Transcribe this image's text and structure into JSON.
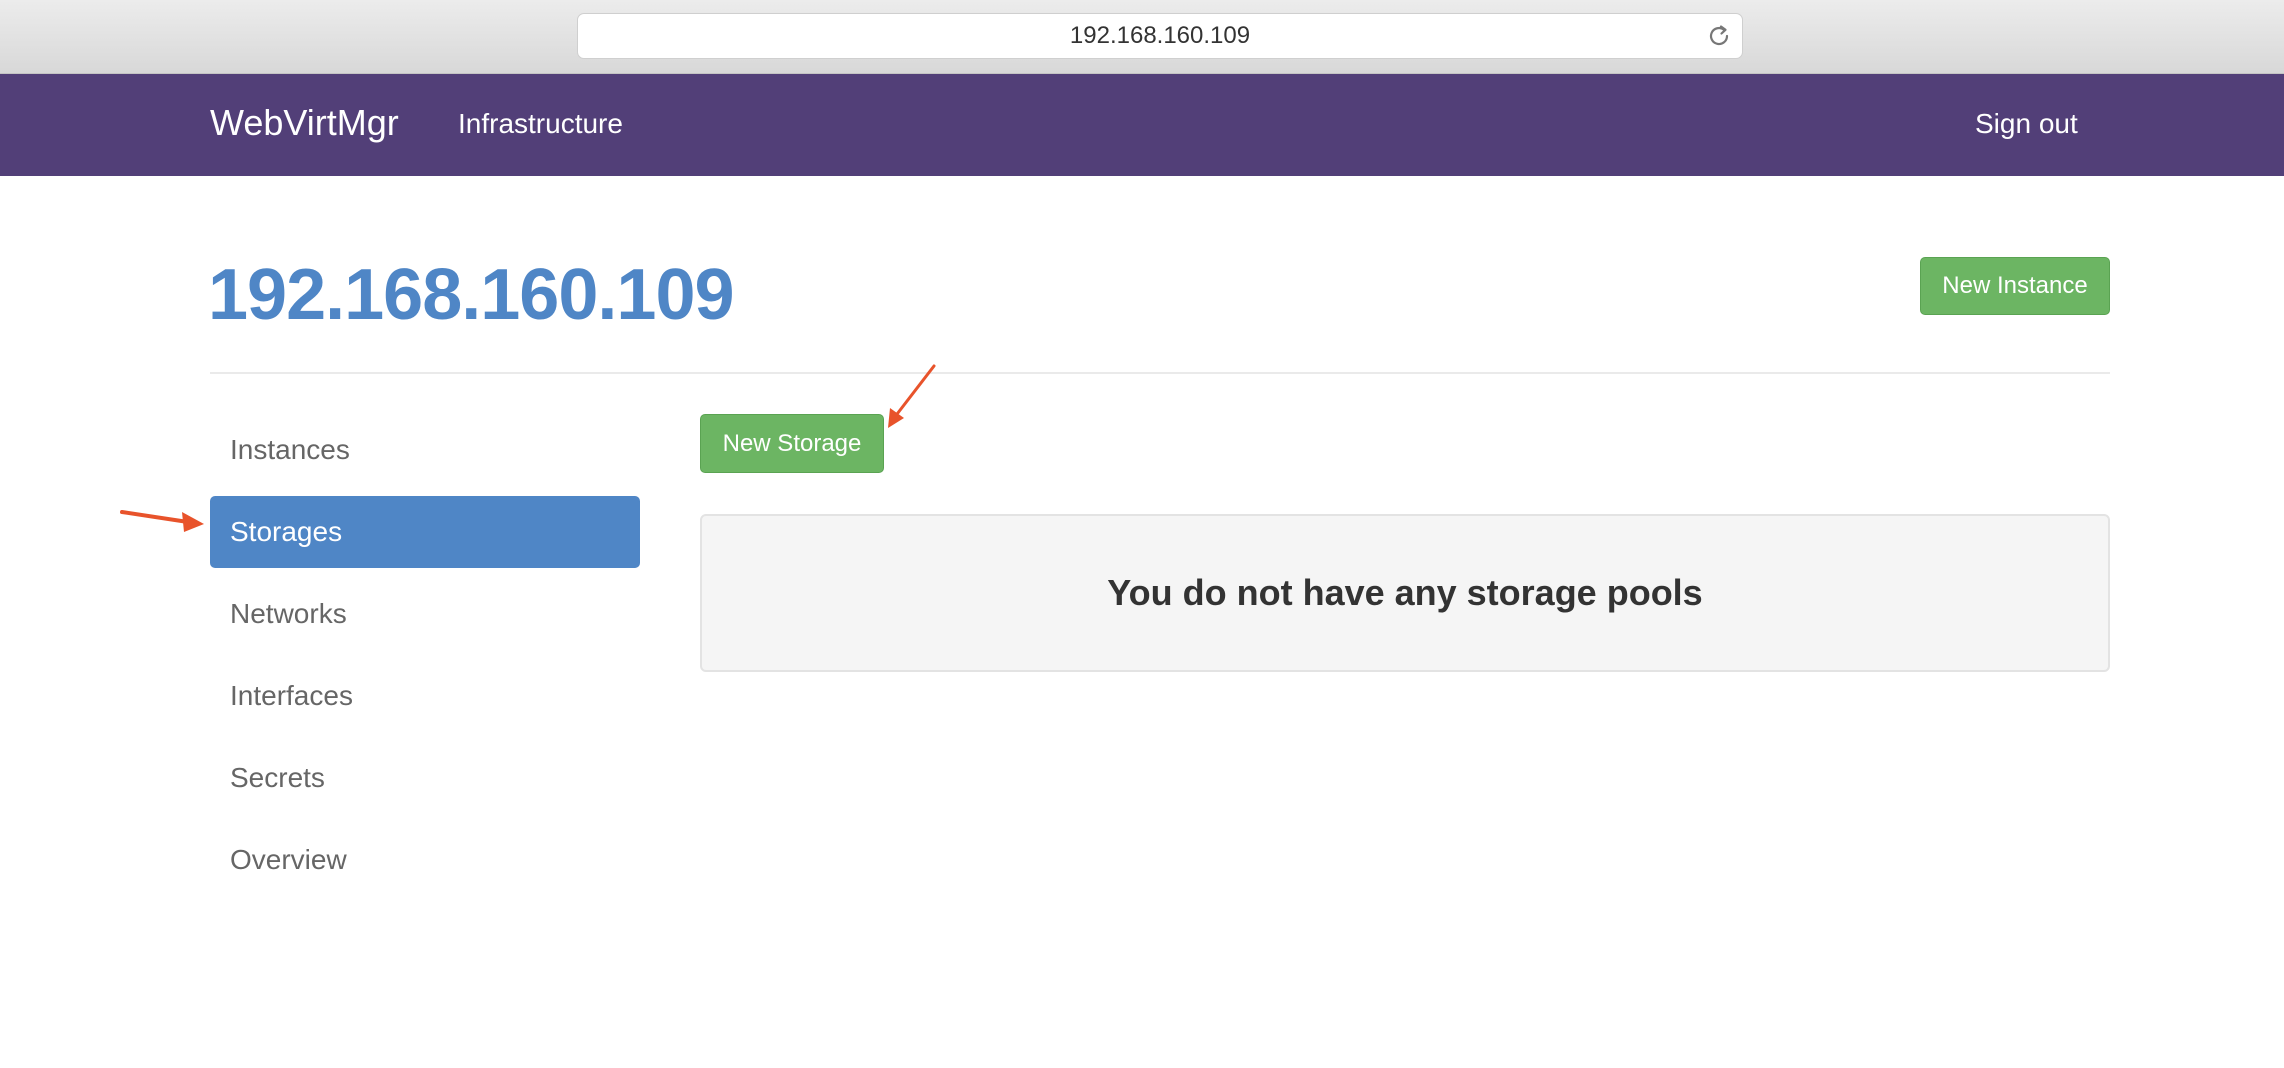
{
  "browser": {
    "address": "192.168.160.109",
    "reload_icon": "reload-icon"
  },
  "navbar": {
    "brand": "WebVirtMgr",
    "infrastructure_link": "Infrastructure",
    "sign_out": "Sign out",
    "background_color": "#523f78"
  },
  "page": {
    "title": "192.168.160.109",
    "new_instance_label": "New Instance"
  },
  "sidebar": {
    "items": [
      {
        "label": "Instances",
        "active": false
      },
      {
        "label": "Storages",
        "active": true
      },
      {
        "label": "Networks",
        "active": false
      },
      {
        "label": "Interfaces",
        "active": false
      },
      {
        "label": "Secrets",
        "active": false
      },
      {
        "label": "Overview",
        "active": false
      }
    ]
  },
  "main": {
    "new_storage_label": "New Storage",
    "empty_message": "You do not have any storage pools"
  },
  "colors": {
    "accent_blue": "#4f86c6",
    "button_green": "#6cb563",
    "annotation_arrow": "#e8532b"
  }
}
